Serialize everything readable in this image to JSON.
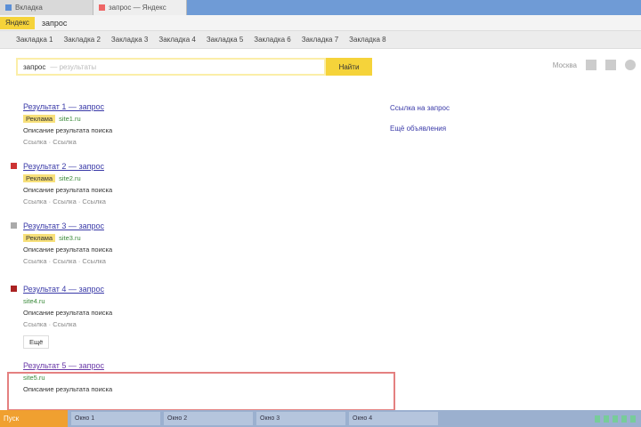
{
  "tabs": [
    {
      "label": "Вкладка"
    },
    {
      "label": "запрос — Яндекс"
    }
  ],
  "address": {
    "site": "Яндекс",
    "query": "запрос"
  },
  "bookmarks": [
    "Закладка 1",
    "Закладка 2",
    "Закладка 3",
    "Закладка 4",
    "Закладка 5",
    "Закладка 6",
    "Закладка 7",
    "Закладка 8"
  ],
  "search": {
    "value": "запрос",
    "hint": "— результаты",
    "button": "Найти",
    "region": "Москва"
  },
  "results": [
    {
      "title": "Результат 1 — запрос",
      "ad": "Реклама",
      "url": "site1.ru",
      "desc": "Описание результата поиска",
      "meta": "Ссылка · Ссылка"
    },
    {
      "title": "Результат 2 — запрос",
      "ad": "Реклама",
      "url": "site2.ru",
      "desc": "Описание результата поиска",
      "meta": "Ссылка · Ссылка · Ссылка"
    },
    {
      "title": "Результат 3 — запрос",
      "ad": "Реклама",
      "url": "site3.ru",
      "desc": "Описание результата поиска",
      "meta": "Ссылка · Ссылка · Ссылка"
    },
    {
      "title": "Результат 4 — запрос",
      "ad": "",
      "url": "site4.ru",
      "desc": "Описание результата поиска",
      "meta": "Ссылка · Ссылка"
    },
    {
      "title": "Результат 5 — запрос",
      "ad": "",
      "url": "site5.ru",
      "desc": "Описание результата поиска",
      "meta": ""
    }
  ],
  "more_button": "Ещё",
  "right": [
    "Ссылка на запрос",
    "Ещё объявления"
  ],
  "taskbar": {
    "start": "Пуск",
    "items": [
      "Окно 1",
      "Окно 2",
      "Окно 3",
      "Окно 4"
    ]
  }
}
